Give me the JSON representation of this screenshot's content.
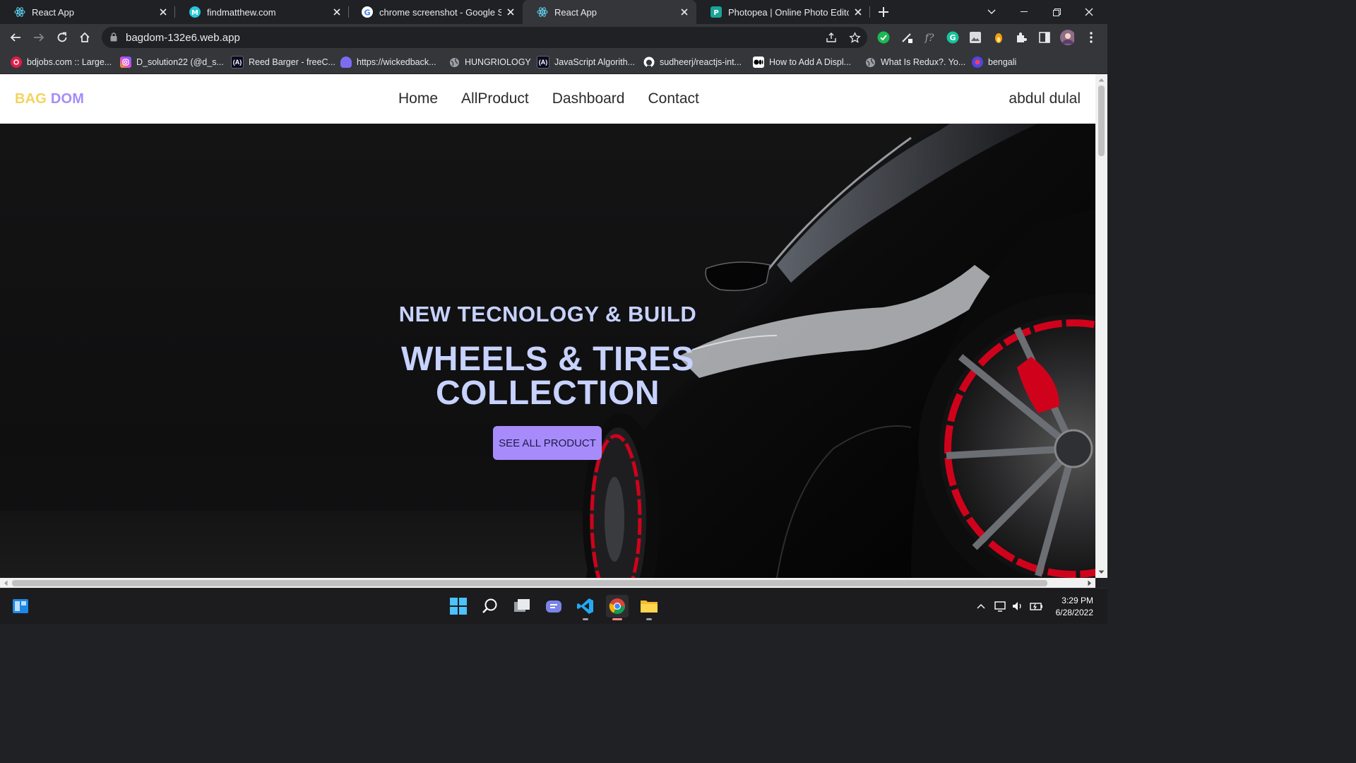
{
  "browser": {
    "tabs": [
      {
        "title": "React App",
        "icon": "react-icon",
        "active": false
      },
      {
        "title": "findmatthew.com",
        "icon": "site-icon",
        "active": false
      },
      {
        "title": "chrome screenshot - Google Sea",
        "icon": "google-icon",
        "active": false
      },
      {
        "title": "React App",
        "icon": "react-icon",
        "active": true
      },
      {
        "title": "Photopea | Online Photo Editor",
        "icon": "photopea-icon",
        "active": false
      }
    ],
    "url": "bagdom-132e6.web.app",
    "bookmarks": [
      {
        "label": "bdjobs.com :: Large...",
        "color": "#e11d48"
      },
      {
        "label": "D_solution22 (@d_s...",
        "color": "#d946ef"
      },
      {
        "label": "Reed Barger - freeC...",
        "color": "#0a0a23"
      },
      {
        "label": "https://wickedback...",
        "color": "#7c6cf0"
      },
      {
        "label": "HUNGRIOLOGY",
        "color": "#6b7280"
      },
      {
        "label": "JavaScript Algorith...",
        "color": "#0a0a23"
      },
      {
        "label": "sudheerj/reactjs-int...",
        "color": "#ffffff"
      },
      {
        "label": "How to Add A Displ...",
        "color": "#000000"
      },
      {
        "label": "What Is Redux?. Yo...",
        "color": "#6b7280"
      },
      {
        "label": "bengali",
        "color": "#4f46e5"
      }
    ]
  },
  "site": {
    "brand_part1": "BAG",
    "brand_part2": "DOM",
    "menu": [
      "Home",
      "AllProduct",
      "Dashboard",
      "Contact"
    ],
    "user": "abdul dulal",
    "hero": {
      "subtitle": "NEW TECNOLOGY & BUILD",
      "title_line1": "WHEELS & TIRES",
      "title_line2": "COLLECTION",
      "cta": "SEE ALL PRODUCT"
    },
    "colors": {
      "brand_yellow": "#f4d35e",
      "brand_purple": "#a78bfa",
      "hero_text": "#c7d2fe",
      "wheel_red": "#d0021b"
    }
  },
  "taskbar": {
    "time": "3:29 PM",
    "date": "6/28/2022"
  }
}
